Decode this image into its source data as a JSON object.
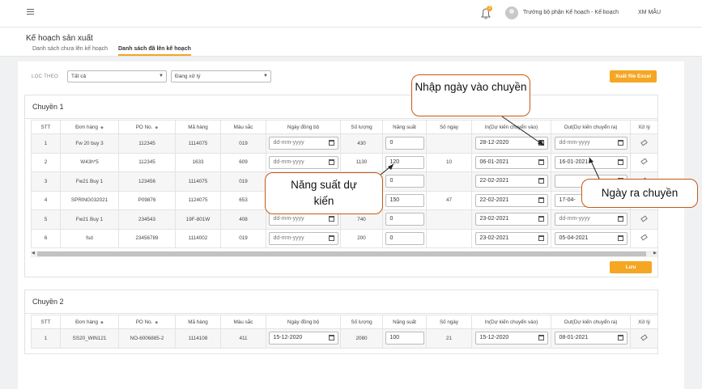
{
  "header": {
    "notification_count": "3",
    "user_name": "Trưởng bộ phận Kế hoạch - Kế hoạch",
    "user_code": "XM MẪU"
  },
  "page": {
    "title": "Kế hoạch sản xuất",
    "tabs": [
      {
        "label": "Danh sách chưa lên kế hoạch",
        "active": false
      },
      {
        "label": "Danh sách đã lên kế hoạch",
        "active": true
      }
    ]
  },
  "filter": {
    "label": "LỌC THEO",
    "select1": "Tất cả",
    "select2": "Đang xử lý",
    "export_label": "Xuất file Excel"
  },
  "columns": [
    "STT",
    "Đơn hàng",
    "PO No.",
    "Mã hàng",
    "Màu sắc",
    "Ngày đồng bộ",
    "Số lượng",
    "Năng suất",
    "Số ngày",
    "In(Dự kiến chuyển vào)",
    "Out(Dự kiến chuyển ra)",
    "Xử lý"
  ],
  "line1": {
    "title": "Chuyền 1",
    "rows": [
      {
        "stt": "1",
        "order": "Fw 20 buy 3",
        "po": "112345",
        "code": "1114075",
        "color": "019",
        "sync": "dd-mm-yyyy",
        "qty": "430",
        "rate": "0",
        "days": "",
        "in": "28-12-2020",
        "out": "dd-mm-yyyy"
      },
      {
        "stt": "2",
        "order": "W43h*5",
        "po": "112345",
        "code": "1633",
        "color": "609",
        "sync": "dd-mm-yyyy",
        "qty": "1130",
        "rate": "120",
        "days": "10",
        "in": "06-01-2021",
        "out": "16-01-2021"
      },
      {
        "stt": "3",
        "order": "Fw21 Buy 1",
        "po": "123456",
        "code": "1114075",
        "color": "019",
        "sync": "dd-mm-yyyy",
        "qty": "",
        "rate": "0",
        "days": "",
        "in": "22-02-2021",
        "out": ""
      },
      {
        "stt": "4",
        "order": "SPRING032021",
        "po": "P09876",
        "code": "1124075",
        "color": "653",
        "sync": "dd-mm-yyyy",
        "qty": "",
        "rate": "150",
        "days": "47",
        "in": "22-02-2021",
        "out": "17-04-"
      },
      {
        "stt": "5",
        "order": "Fw21 Buy 1",
        "po": "234543",
        "code": "19F-801W",
        "color": "408",
        "sync": "dd-mm-yyyy",
        "qty": "740",
        "rate": "0",
        "days": "",
        "in": "23-02-2021",
        "out": "dd-mm-yyyy"
      },
      {
        "stt": "6",
        "order": "fsd",
        "po": "23456789",
        "code": "1114002",
        "color": "019",
        "sync": "dd-mm-yyyy",
        "qty": "200",
        "rate": "0",
        "days": "",
        "in": "23-02-2021",
        "out": "05-04-2021"
      }
    ],
    "save_label": "Lưu"
  },
  "line2": {
    "title": "Chuyền 2",
    "rows": [
      {
        "stt": "1",
        "order": "SS20_WIN121",
        "po": "NO-6006885-2",
        "code": "1114108",
        "color": "411",
        "sync": "15-12-2020",
        "qty": "2080",
        "rate": "100",
        "days": "21",
        "in": "15-12-2020",
        "out": "08-01-2021"
      }
    ]
  },
  "callouts": {
    "in_date": "Nhập ngày vào chuyền",
    "rate": "Năng suất dự kiến",
    "out_date": "Ngày ra chuyền"
  },
  "colors": {
    "accent": "#f5a623",
    "callout_border": "#c55a11"
  }
}
